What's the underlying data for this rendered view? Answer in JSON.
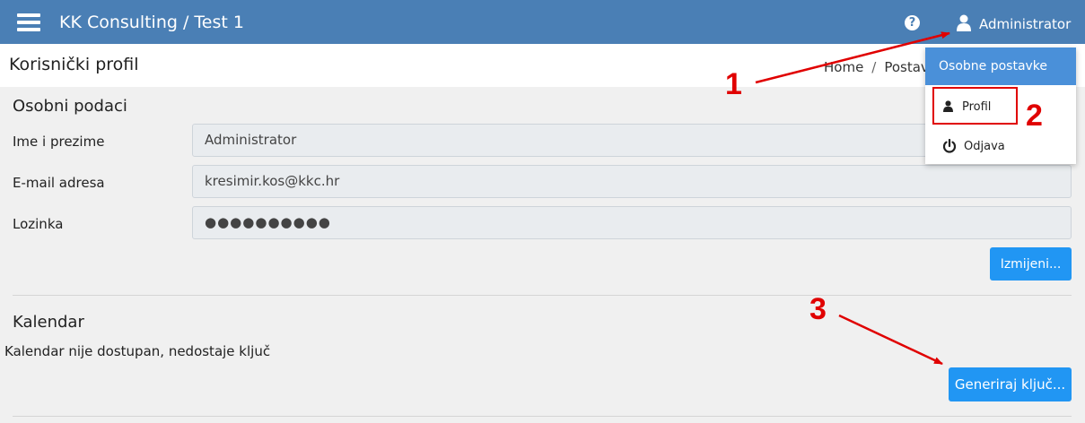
{
  "header": {
    "title": "KK Consulting / Test 1",
    "user_name": "Administrator",
    "icons": {
      "menu": "hamburger-icon",
      "help": "question-circle-icon",
      "user": "user-icon"
    }
  },
  "page": {
    "title": "Korisnički profil",
    "breadcrumb": [
      "Home",
      "/",
      "Postav"
    ]
  },
  "personal": {
    "section_title": "Osobni podaci",
    "name_label": "Ime i prezime",
    "name_value": "Administrator",
    "email_label": "E-mail adresa",
    "email_value": "kresimir.kos@kkc.hr",
    "password_label": "Lozinka",
    "password_value": "●●●●●●●●●●",
    "edit_button": "Izmijeni..."
  },
  "calendar": {
    "section_title": "Kalendar",
    "status_text": "Kalendar nije dostupan, nedostaje ključ",
    "generate_button": "Generiraj ključ..."
  },
  "dropdown": {
    "header": "Osobne postavke",
    "items": [
      {
        "label": "Profil",
        "icon": "user-icon"
      },
      {
        "label": "Odjava",
        "icon": "power-icon"
      }
    ]
  },
  "annotations": {
    "labels": [
      "1",
      "2",
      "3"
    ],
    "color": "#e00000"
  },
  "colors": {
    "topbar": "#4a7fb5",
    "dropdown_header": "#4a90d9",
    "button": "#2196f3"
  }
}
